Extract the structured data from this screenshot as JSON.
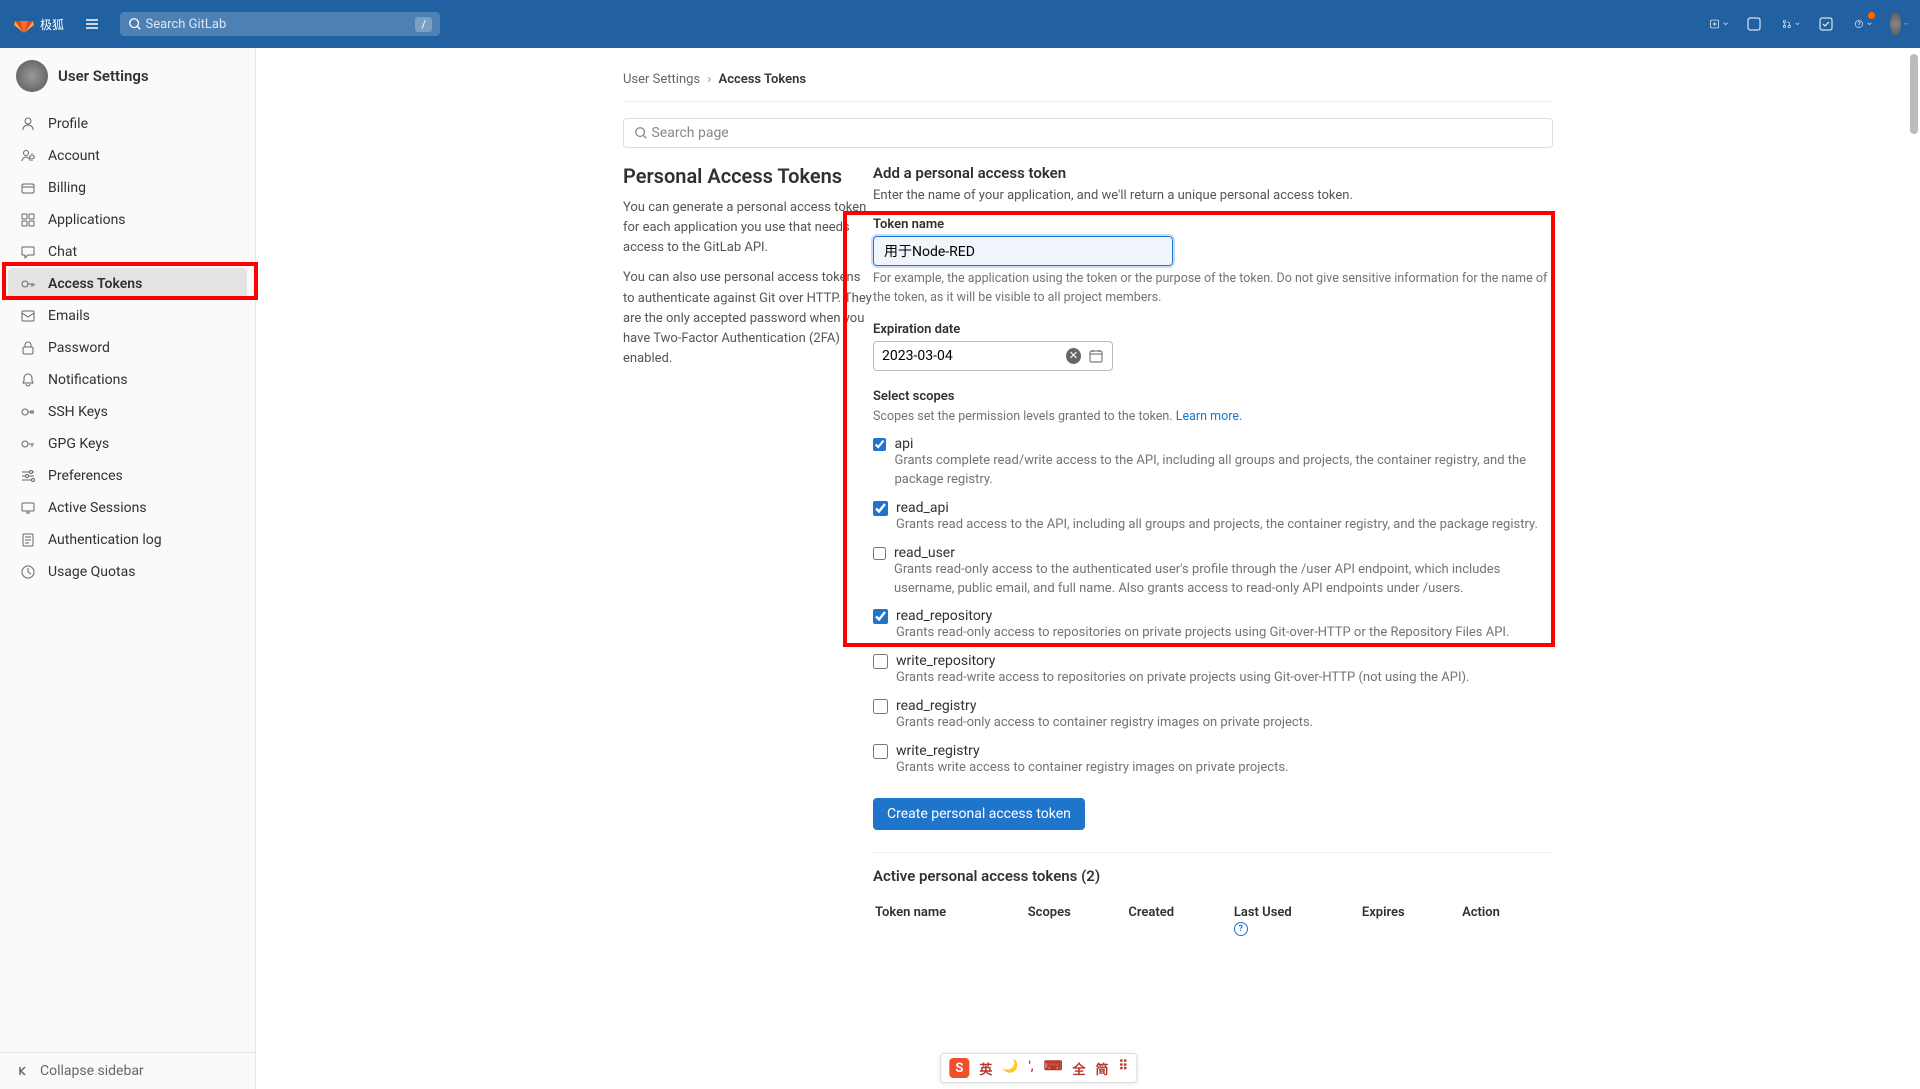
{
  "topbar": {
    "search_placeholder": "Search GitLab",
    "search_kbd": "/",
    "logo_text": "极狐"
  },
  "sidebar": {
    "title": "User Settings",
    "items": [
      {
        "icon": "profile",
        "label": "Profile"
      },
      {
        "icon": "account",
        "label": "Account"
      },
      {
        "icon": "billing",
        "label": "Billing"
      },
      {
        "icon": "apps",
        "label": "Applications"
      },
      {
        "icon": "chat",
        "label": "Chat"
      },
      {
        "icon": "token",
        "label": "Access Tokens"
      },
      {
        "icon": "emails",
        "label": "Emails"
      },
      {
        "icon": "password",
        "label": "Password"
      },
      {
        "icon": "notif",
        "label": "Notifications"
      },
      {
        "icon": "ssh",
        "label": "SSH Keys"
      },
      {
        "icon": "gpg",
        "label": "GPG Keys"
      },
      {
        "icon": "prefs",
        "label": "Preferences"
      },
      {
        "icon": "sessions",
        "label": "Active Sessions"
      },
      {
        "icon": "authlog",
        "label": "Authentication log"
      },
      {
        "icon": "usage",
        "label": "Usage Quotas"
      }
    ],
    "collapse": "Collapse sidebar"
  },
  "breadcrumb": {
    "parent": "User Settings",
    "current": "Access Tokens"
  },
  "page_search_placeholder": "Search page",
  "left": {
    "title": "Personal Access Tokens",
    "p1": "You can generate a personal access token for each application you use that needs access to the GitLab API.",
    "p2": "You can also use personal access tokens to authenticate against Git over HTTP. They are the only accepted password when you have Two-Factor Authentication (2FA) enabled."
  },
  "form": {
    "heading": "Add a personal access token",
    "intro": "Enter the name of your application, and we'll return a unique personal access token.",
    "token_name_label": "Token name",
    "token_name_value": "用于Node-RED",
    "token_name_help": "For example, the application using the token or the purpose of the token. Do not give sensitive information for the name of the token, as it will be visible to all project members.",
    "expiration_label": "Expiration date",
    "expiration_value": "2023-03-04",
    "scopes_label": "Select scopes",
    "scopes_intro": "Scopes set the permission levels granted to the token. ",
    "learn_more": "Learn more.",
    "scopes": [
      {
        "name": "api",
        "checked": true,
        "desc": "Grants complete read/write access to the API, including all groups and projects, the container registry, and the package registry."
      },
      {
        "name": "read_api",
        "checked": true,
        "desc": "Grants read access to the API, including all groups and projects, the container registry, and the package registry."
      },
      {
        "name": "read_user",
        "checked": false,
        "desc": "Grants read-only access to the authenticated user's profile through the /user API endpoint, which includes username, public email, and full name. Also grants access to read-only API endpoints under /users."
      },
      {
        "name": "read_repository",
        "checked": true,
        "desc": "Grants read-only access to repositories on private projects using Git-over-HTTP or the Repository Files API."
      },
      {
        "name": "write_repository",
        "checked": false,
        "desc": "Grants read-write access to repositories on private projects using Git-over-HTTP (not using the API)."
      },
      {
        "name": "read_registry",
        "checked": false,
        "desc": "Grants read-only access to container registry images on private projects."
      },
      {
        "name": "write_registry",
        "checked": false,
        "desc": "Grants write access to container registry images on private projects."
      }
    ],
    "create_btn": "Create personal access token"
  },
  "active": {
    "title": "Active personal access tokens (2)",
    "cols": [
      "Token name",
      "Scopes",
      "Created",
      "Last Used",
      "Expires",
      "Action"
    ]
  },
  "ime": {
    "items": [
      "英",
      "🌙",
      "',",
      "⌨",
      "全",
      "简",
      "⠿"
    ]
  }
}
